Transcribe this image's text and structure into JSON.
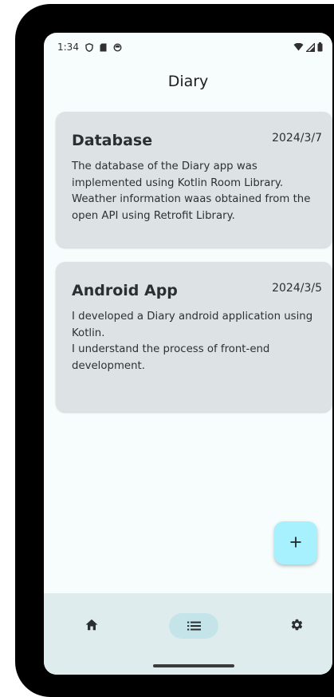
{
  "status_bar": {
    "time": "1:34",
    "icons_left": [
      "shield-icon",
      "sd-card-icon",
      "sync-icon"
    ],
    "icons_right": [
      "wifi-icon",
      "signal-icon",
      "battery-icon"
    ]
  },
  "header": {
    "title": "Diary"
  },
  "entries": [
    {
      "title": "Database",
      "date": "2024/3/7",
      "body": "The database of the Diary app was implemented using Kotlin Room Library.\nWeather information waas obtained from the open API using Retrofit Library."
    },
    {
      "title": "Android App",
      "date": "2024/3/5",
      "body": "I developed a Diary android application using Kotlin.\nI understand the process of front-end development."
    }
  ],
  "fab": {
    "icon": "plus-icon",
    "label": "+"
  },
  "bottom_nav": {
    "items": [
      {
        "icon": "home-icon"
      },
      {
        "icon": "list-icon",
        "selected": true
      },
      {
        "icon": "gear-icon"
      }
    ]
  },
  "colors": {
    "screen_background": "#f7fcfc",
    "card_background": "#dde3e5",
    "fab_background": "#a6f1fd",
    "nav_background": "#deecee",
    "nav_selected_background": "#c5e4ea"
  }
}
